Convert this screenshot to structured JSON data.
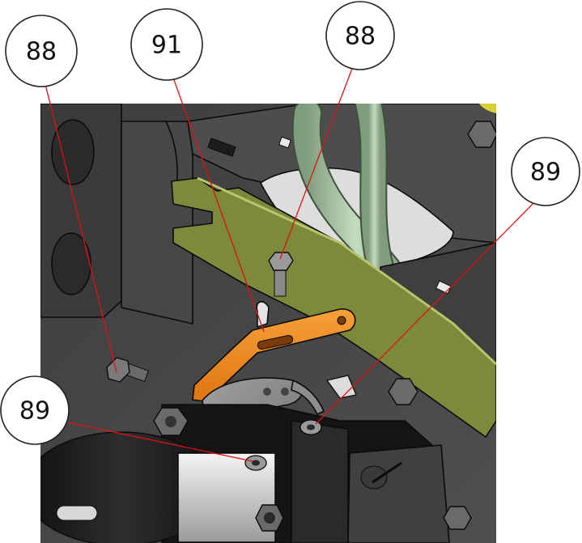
{
  "diagram": {
    "callouts": [
      {
        "id": "c1",
        "label": "88"
      },
      {
        "id": "c2",
        "label": "91"
      },
      {
        "id": "c3",
        "label": "88"
      },
      {
        "id": "c4",
        "label": "89"
      },
      {
        "id": "c5",
        "label": "89"
      }
    ],
    "colors": {
      "frame": "#4a4a4a",
      "frame_light": "#5c5c5c",
      "green_plate": "#7c8a3c",
      "hose": "#a6c3a2",
      "orange_bracket": "#f28c1c",
      "steel_strap": "#8c8c8c",
      "motor_black": "#1c1c1c",
      "leader_line": "#e01010"
    }
  }
}
